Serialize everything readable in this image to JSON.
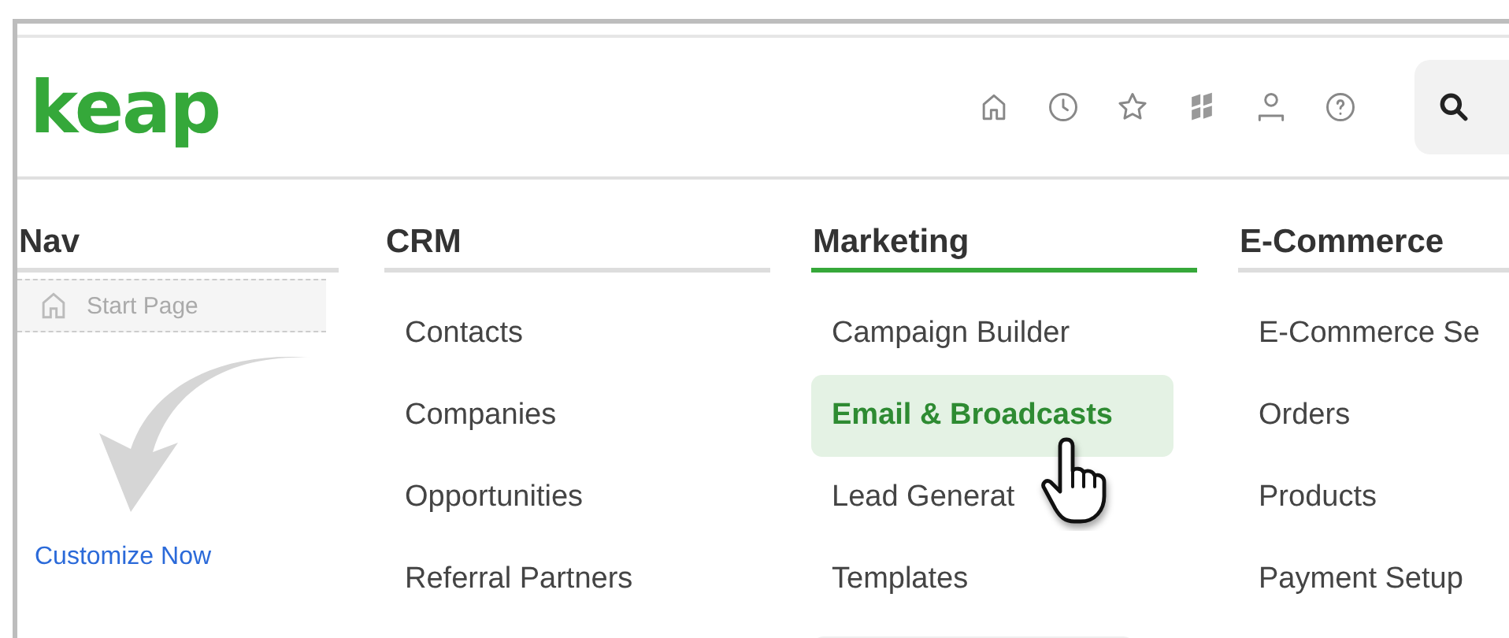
{
  "header": {
    "logo": "keap"
  },
  "nav": {
    "title": "Nav",
    "start_page": "Start Page",
    "link": "Customize Now"
  },
  "columns": [
    {
      "title": "CRM",
      "selected": false,
      "items": [
        {
          "label": "Contacts",
          "selected": false
        },
        {
          "label": "Companies",
          "selected": false
        },
        {
          "label": "Opportunities",
          "selected": false
        },
        {
          "label": "Referral Partners",
          "selected": false
        }
      ]
    },
    {
      "title": "Marketing",
      "selected": true,
      "items": [
        {
          "label": "Campaign Builder",
          "selected": false
        },
        {
          "label": "Email & Broadcasts",
          "selected": true
        },
        {
          "label": "Lead Generat",
          "selected": false
        },
        {
          "label": "Templates",
          "selected": false
        }
      ]
    },
    {
      "title": "E-Commerce",
      "selected": false,
      "items": [
        {
          "label": "E-Commerce Se",
          "selected": false
        },
        {
          "label": "Orders",
          "selected": false
        },
        {
          "label": "Products",
          "selected": false
        },
        {
          "label": "Payment Setup",
          "selected": false
        }
      ]
    }
  ]
}
